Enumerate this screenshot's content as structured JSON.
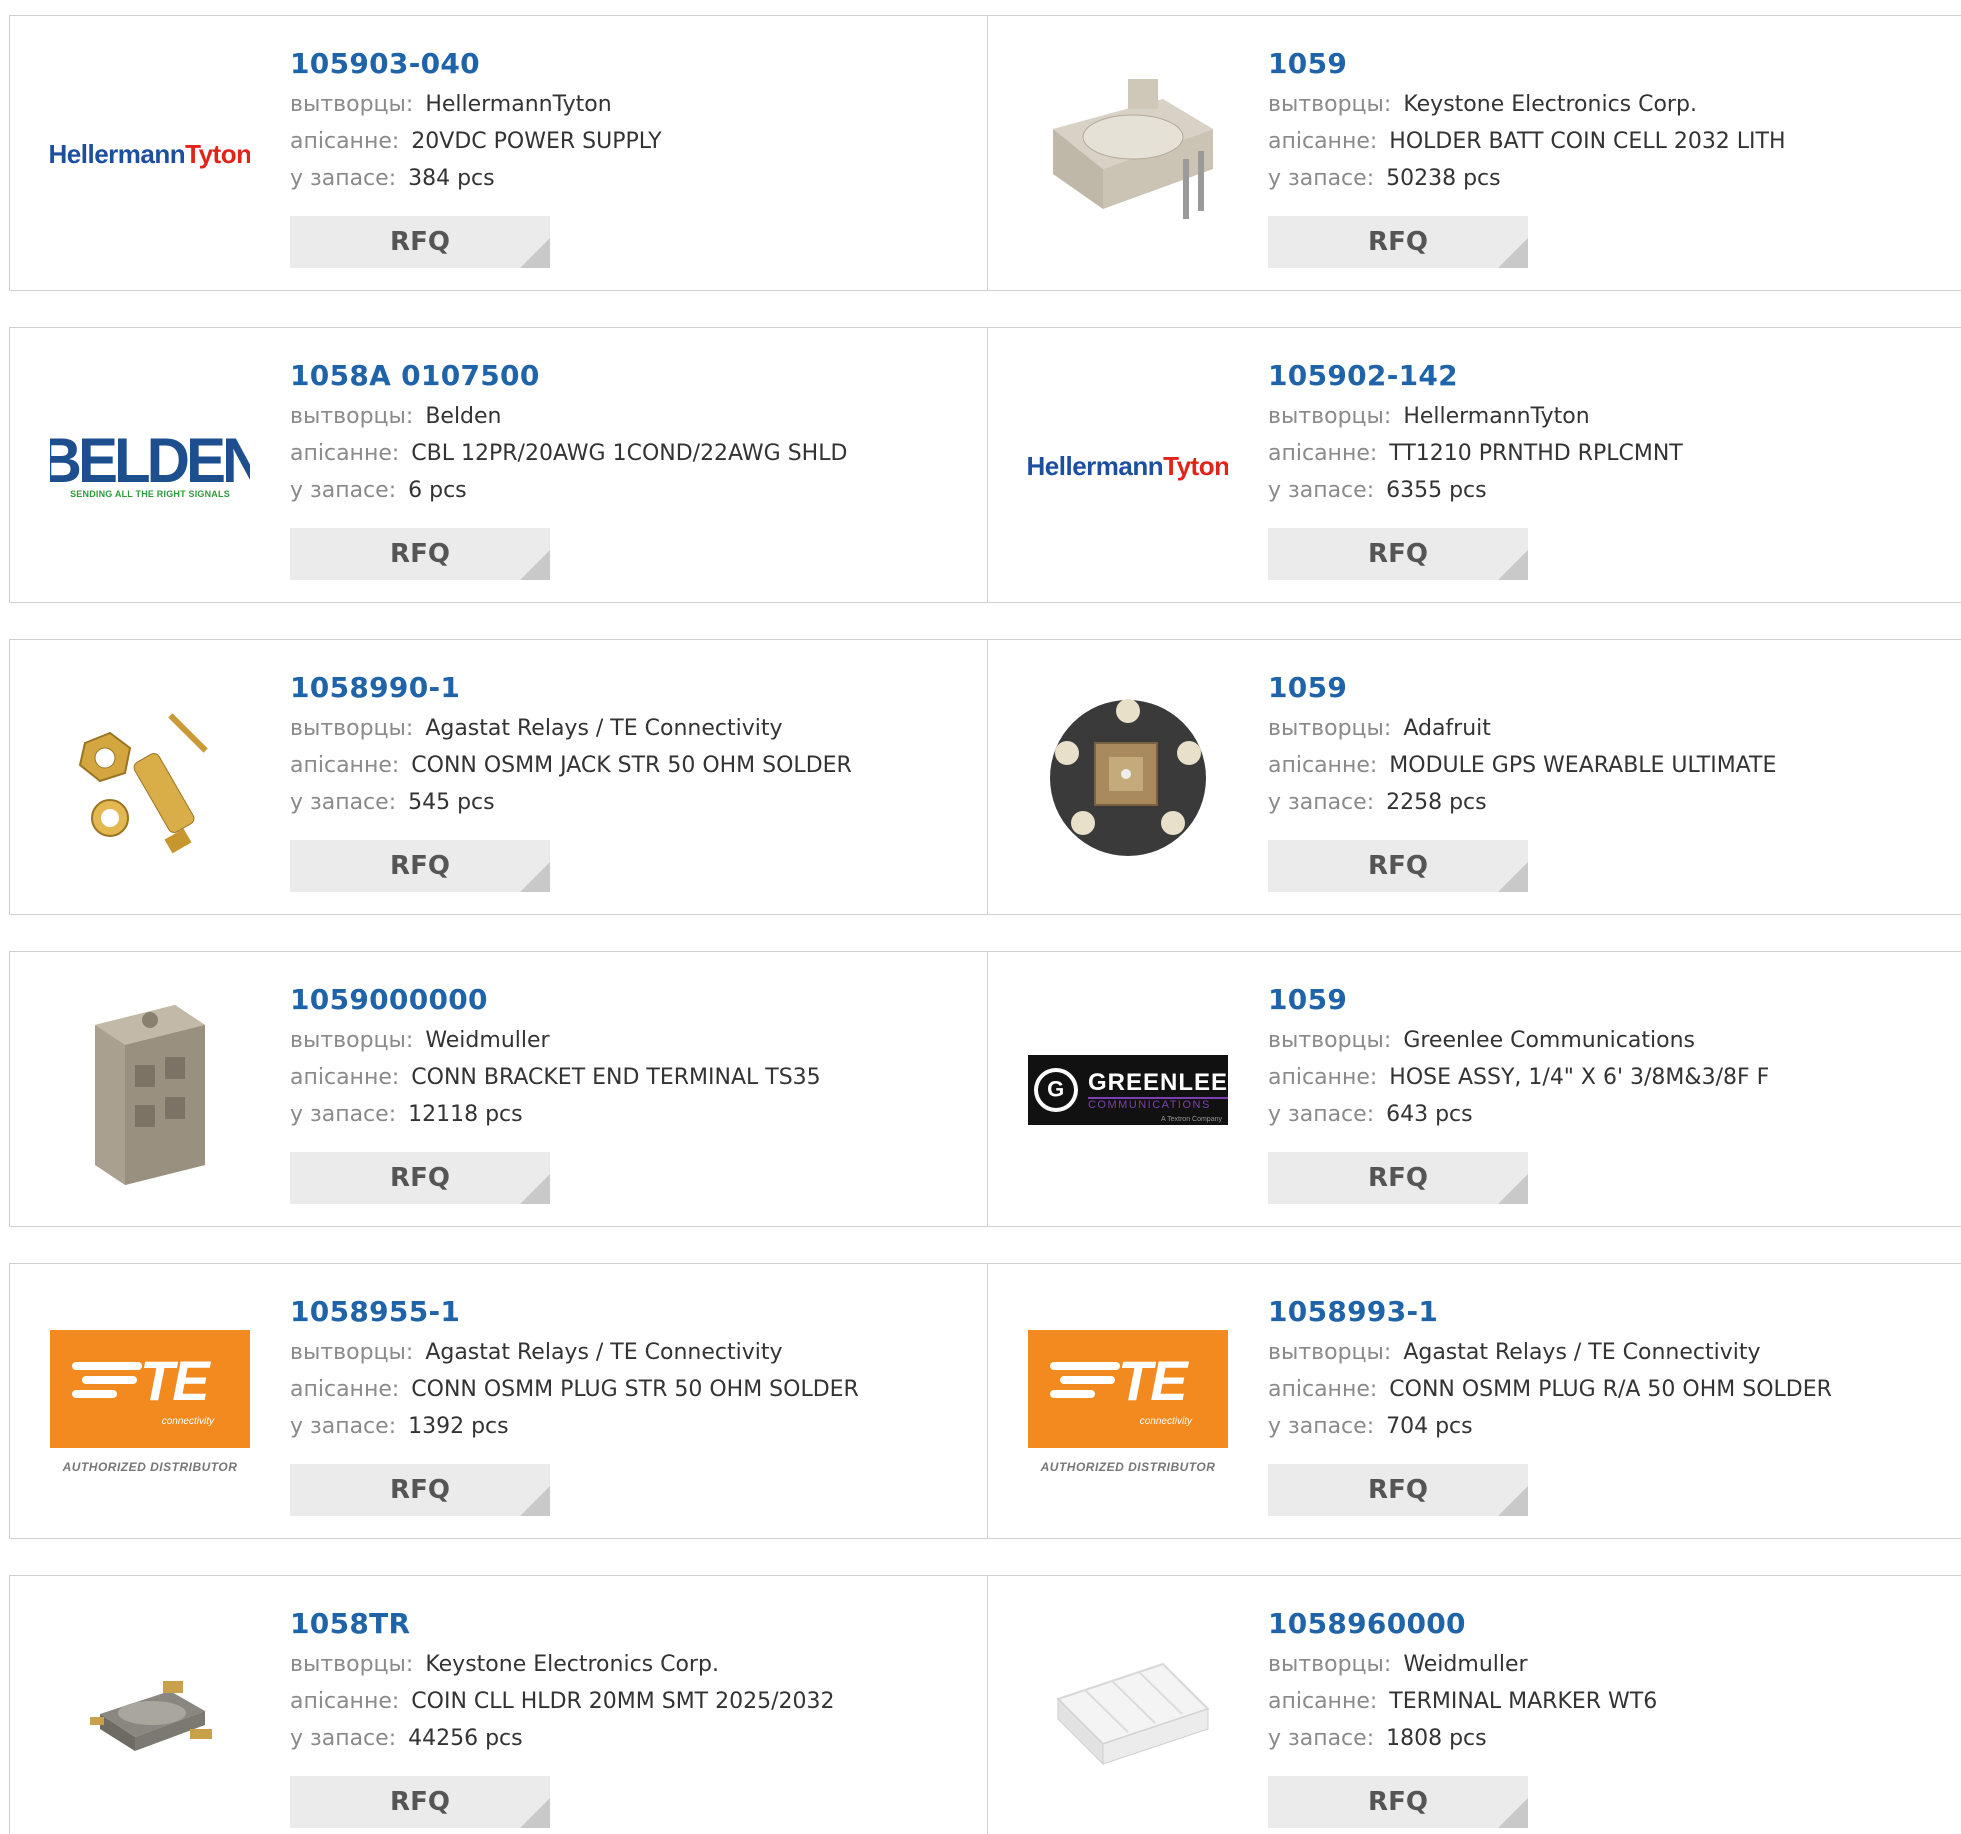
{
  "labels": {
    "manufacturer": "вытворцы:",
    "description": "апісанне:",
    "stock": "у запасе:",
    "rfq": "RFQ"
  },
  "logos": {
    "hellermann_a": "Hellermann",
    "hellermann_b": "Tyton",
    "belden_main": "BELDEN",
    "belden_tag": "SENDING ALL THE RIGHT SIGNALS",
    "te_main": "TE",
    "te_sub": "connectivity",
    "te_auth": "AUTHORIZED DISTRIBUTOR",
    "greenlee_g": "G",
    "greenlee_main": "GREENLEE",
    "greenlee_sub": "COMMUNICATIONS",
    "greenlee_tag": "A Textron Company"
  },
  "products": [
    {
      "part": "105903-040",
      "manufacturer": "HellermannTyton",
      "description": "20VDC POWER SUPPLY",
      "stock": "384 pcs",
      "image": "hellermann-logo"
    },
    {
      "part": "1059",
      "manufacturer": "Keystone Electronics Corp.",
      "description": "HOLDER BATT COIN CELL 2032 LITH",
      "stock": "50238 pcs",
      "image": "coin-cell-holder-photo"
    },
    {
      "part": "1058A 0107500",
      "manufacturer": "Belden",
      "description": "CBL 12PR/20AWG 1COND/22AWG SHLD",
      "stock": "6 pcs",
      "image": "belden-logo"
    },
    {
      "part": "105902-142",
      "manufacturer": "HellermannTyton",
      "description": "TT1210 PRNTHD RPLCMNT",
      "stock": "6355 pcs",
      "image": "hellermann-logo"
    },
    {
      "part": "1058990-1",
      "manufacturer": "Agastat Relays / TE Connectivity",
      "description": "CONN OSMM JACK STR 50 OHM SOLDER",
      "stock": "545 pcs",
      "image": "connector-jack-photo"
    },
    {
      "part": "1059",
      "manufacturer": "Adafruit",
      "description": "MODULE GPS WEARABLE ULTIMATE",
      "stock": "2258 pcs",
      "image": "gps-module-photo"
    },
    {
      "part": "1059000000",
      "manufacturer": "Weidmuller",
      "description": "CONN BRACKET END TERMINAL TS35",
      "stock": "12118 pcs",
      "image": "terminal-bracket-photo"
    },
    {
      "part": "1059",
      "manufacturer": "Greenlee Communications",
      "description": "HOSE ASSY, 1/4\" X 6' 3/8M&3/8F F",
      "stock": "643 pcs",
      "image": "greenlee-logo"
    },
    {
      "part": "1058955-1",
      "manufacturer": "Agastat Relays / TE Connectivity",
      "description": "CONN OSMM PLUG STR 50 OHM SOLDER",
      "stock": "1392 pcs",
      "image": "te-connectivity-logo"
    },
    {
      "part": "1058993-1",
      "manufacturer": "Agastat Relays / TE Connectivity",
      "description": "CONN OSMM PLUG R/A 50 OHM SOLDER",
      "stock": "704 pcs",
      "image": "te-connectivity-logo"
    },
    {
      "part": "1058TR",
      "manufacturer": "Keystone Electronics Corp.",
      "description": "COIN CLL HLDR 20MM SMT 2025/2032",
      "stock": "44256 pcs",
      "image": "smt-coin-holder-photo"
    },
    {
      "part": "1058960000",
      "manufacturer": "Weidmuller",
      "description": "TERMINAL MARKER WT6",
      "stock": "1808 pcs",
      "image": "terminal-marker-photo"
    }
  ]
}
